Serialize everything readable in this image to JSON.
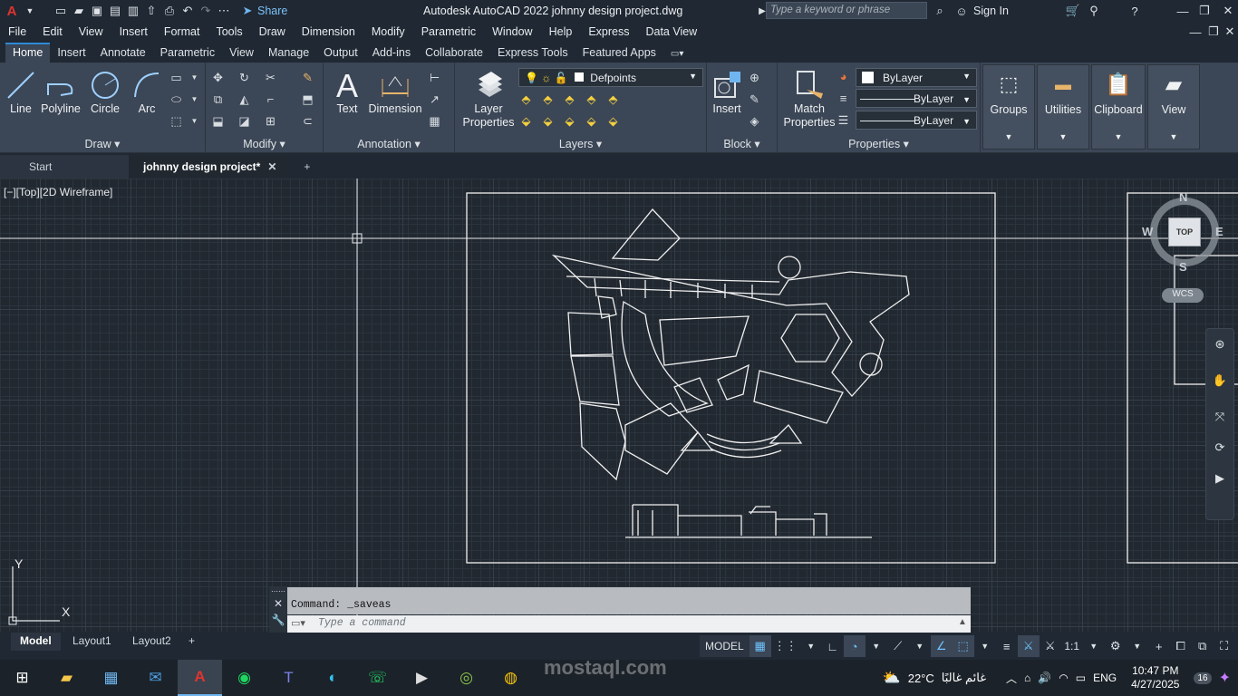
{
  "window": {
    "title": "Autodesk AutoCAD 2022    johnny design project.dwg",
    "share_label": "Share",
    "search_placeholder": "Type a keyword or phrase",
    "sign_in": "Sign In"
  },
  "menu": [
    "File",
    "Edit",
    "View",
    "Insert",
    "Format",
    "Tools",
    "Draw",
    "Dimension",
    "Modify",
    "Parametric",
    "Window",
    "Help",
    "Express",
    "Data View"
  ],
  "ribbon_tabs": [
    "Home",
    "Insert",
    "Annotate",
    "Parametric",
    "View",
    "Manage",
    "Output",
    "Add-ins",
    "Collaborate",
    "Express Tools",
    "Featured Apps"
  ],
  "ribbon": {
    "draw": {
      "title": "Draw",
      "line": "Line",
      "polyline": "Polyline",
      "circle": "Circle",
      "arc": "Arc"
    },
    "modify": {
      "title": "Modify"
    },
    "annotation": {
      "title": "Annotation",
      "text": "Text",
      "dimension": "Dimension"
    },
    "layers": {
      "title": "Layers",
      "layer_properties": "Layer Properties",
      "current_layer": "Defpoints"
    },
    "block": {
      "title": "Block",
      "insert": "Insert"
    },
    "properties": {
      "title": "Properties",
      "match": "Match Properties",
      "color": "ByLayer",
      "linetype": "ByLayer",
      "lineweight": "ByLayer"
    },
    "groups": "Groups",
    "utilities": "Utilities",
    "clipboard": "Clipboard",
    "view": "View"
  },
  "doc_tabs": [
    "Start",
    "johnny design project*"
  ],
  "viewport_label": "[−][Top][2D Wireframe]",
  "viewcube": {
    "n": "N",
    "s": "S",
    "e": "E",
    "w": "W",
    "face": "TOP",
    "ucs": "WCS"
  },
  "ucs_icon": {
    "x": "X",
    "y": "Y"
  },
  "command": {
    "history": "Command: _saveas",
    "placeholder": "Type a command"
  },
  "layouts": [
    "Model",
    "Layout1",
    "Layout2"
  ],
  "status": {
    "model": "MODEL",
    "scale": "1:1"
  },
  "taskbar": {
    "weather": "22°C",
    "weather_text": "غائم غالبًا",
    "lang": "ENG",
    "time": "10:47 PM",
    "date": "4/27/2025",
    "notif": "16"
  },
  "watermark": "mostaql.com",
  "colors": {
    "accent": "#2e8ad8",
    "canvas": "#212830",
    "ribbon": "#3b4656"
  }
}
